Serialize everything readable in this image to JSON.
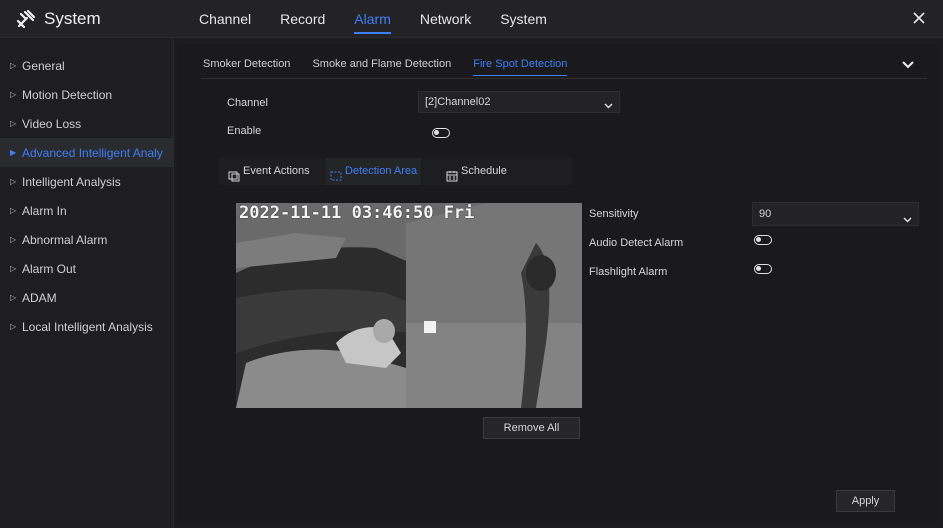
{
  "app": {
    "title": "System"
  },
  "topnav": [
    "Channel",
    "Record",
    "Alarm",
    "Network",
    "System"
  ],
  "topnav_active": 2,
  "sidebar": {
    "items": [
      {
        "label": "General"
      },
      {
        "label": "Motion Detection"
      },
      {
        "label": "Video Loss"
      },
      {
        "label": "Advanced Intelligent Analy"
      },
      {
        "label": "Intelligent Analysis"
      },
      {
        "label": "Alarm In"
      },
      {
        "label": "Abnormal Alarm"
      },
      {
        "label": "Alarm Out"
      },
      {
        "label": "ADAM"
      },
      {
        "label": "Local Intelligent Analysis"
      }
    ],
    "active_index": 3
  },
  "subtabs": [
    "Smoker Detection",
    "Smoke and Flame Detection",
    "Fire Spot Detection"
  ],
  "subtabs_active": 2,
  "form": {
    "channel_label": "Channel",
    "channel_value": "[2]Channel02",
    "enable_label": "Enable"
  },
  "mode_tabs": {
    "event_actions": "Event Actions",
    "detection_area": "Detection Area",
    "schedule": "Schedule",
    "active": "detection_area"
  },
  "video": {
    "osd": "2022-11-11 03:46:50 Fri"
  },
  "settings": {
    "sensitivity_label": "Sensitivity",
    "sensitivity_value": "90",
    "audio_label": "Audio Detect Alarm",
    "flash_label": "Flashlight Alarm"
  },
  "buttons": {
    "remove_all": "Remove All",
    "apply": "Apply"
  },
  "colors": {
    "accent": "#3e7ef7",
    "background": "#1c1c1e",
    "panel": "#232325"
  },
  "icons": {
    "brand": "tools-icon",
    "close": "close-icon",
    "caret": "triangle-right-icon",
    "collapse": "chevron-down-icon",
    "event": "event-actions-icon",
    "area": "detection-area-icon",
    "schedule": "calendar-icon"
  }
}
